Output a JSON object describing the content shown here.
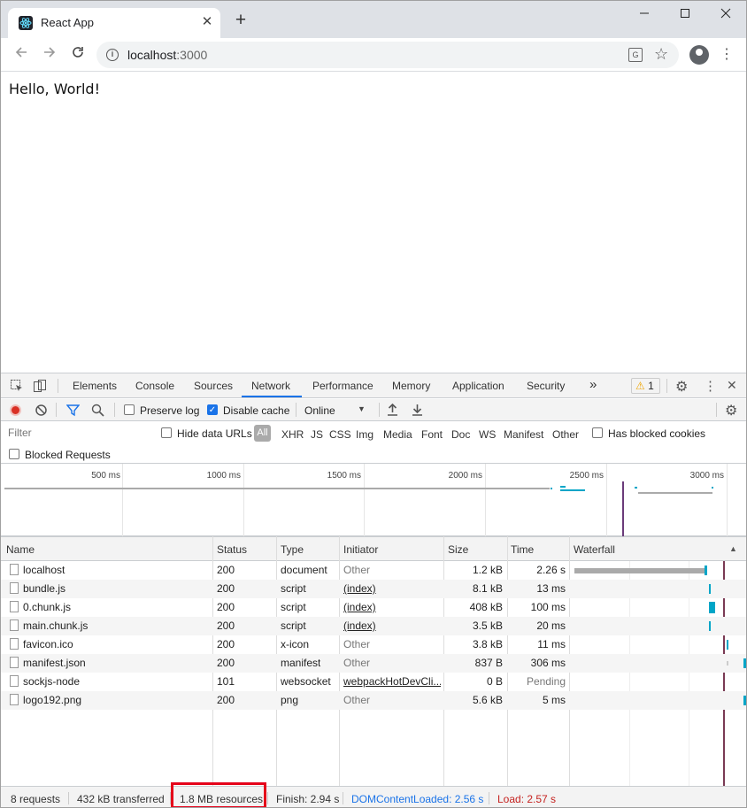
{
  "browser": {
    "tab_title": "React App",
    "new_tab_symbol": "+",
    "url_host": "localhost",
    "url_port": ":3000"
  },
  "page": {
    "text": "Hello, World!"
  },
  "devtools": {
    "tabs": [
      "Elements",
      "Console",
      "Sources",
      "Network",
      "Performance",
      "Memory",
      "Application",
      "Security"
    ],
    "active_tab": "Network",
    "more_tabs": "»",
    "warning_count": "1",
    "controls": {
      "preserve_log": "Preserve log",
      "disable_cache": "Disable cache",
      "throttle": "Online"
    },
    "filter": {
      "placeholder": "Filter",
      "hide_data_urls": "Hide data URLs",
      "all": "All",
      "types": [
        "XHR",
        "JS",
        "CSS",
        "Img",
        "Media",
        "Font",
        "Doc",
        "WS",
        "Manifest",
        "Other"
      ],
      "has_blocked_cookies": "Has blocked cookies",
      "blocked_requests": "Blocked Requests"
    },
    "overview_ticks": [
      "500 ms",
      "1000 ms",
      "1500 ms",
      "2000 ms",
      "2500 ms",
      "3000 ms"
    ],
    "columns": {
      "name": "Name",
      "status": "Status",
      "type": "Type",
      "initiator": "Initiator",
      "size": "Size",
      "time": "Time",
      "waterfall": "Waterfall"
    },
    "requests": [
      {
        "name": "localhost",
        "status": "200",
        "type": "document",
        "initiator": "Other",
        "initiator_link": false,
        "size": "1.2 kB",
        "time": "2.26 s"
      },
      {
        "name": "bundle.js",
        "status": "200",
        "type": "script",
        "initiator": "(index)",
        "initiator_link": true,
        "size": "8.1 kB",
        "time": "13 ms"
      },
      {
        "name": "0.chunk.js",
        "status": "200",
        "type": "script",
        "initiator": "(index)",
        "initiator_link": true,
        "size": "408 kB",
        "time": "100 ms"
      },
      {
        "name": "main.chunk.js",
        "status": "200",
        "type": "script",
        "initiator": "(index)",
        "initiator_link": true,
        "size": "3.5 kB",
        "time": "20 ms"
      },
      {
        "name": "favicon.ico",
        "status": "200",
        "type": "x-icon",
        "initiator": "Other",
        "initiator_link": false,
        "size": "3.8 kB",
        "time": "11 ms"
      },
      {
        "name": "manifest.json",
        "status": "200",
        "type": "manifest",
        "initiator": "Other",
        "initiator_link": false,
        "size": "837 B",
        "time": "306 ms"
      },
      {
        "name": "sockjs-node",
        "status": "101",
        "type": "websocket",
        "initiator": "webpackHotDevCli...",
        "initiator_link": true,
        "size": "0 B",
        "time": "Pending"
      },
      {
        "name": "logo192.png",
        "status": "200",
        "type": "png",
        "initiator": "Other",
        "initiator_link": false,
        "size": "5.6 kB",
        "time": "5 ms"
      }
    ],
    "status_bar": {
      "requests": "8 requests",
      "transferred": "432 kB transferred",
      "resources": "1.8 MB resources",
      "finish": "Finish: 2.94 s",
      "dom_content_loaded": "DOMContentLoaded: 2.56 s",
      "load": "Load: 2.57 s"
    },
    "colors": {
      "dcl_line": "#1a73e8",
      "load_line": "#c5221f",
      "bar_teal": "#00a5c7",
      "bar_grey": "#aaaaaa",
      "highlight": "#e5001a"
    }
  }
}
